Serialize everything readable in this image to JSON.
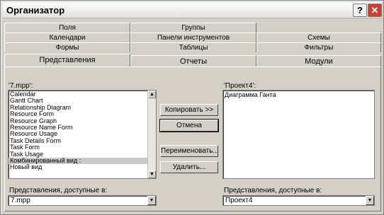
{
  "window": {
    "title": "Организатор",
    "help_label": "?",
    "close_label": "✕"
  },
  "tabs": {
    "row1": [
      "Поля",
      "Группы"
    ],
    "row2": [
      "Календари",
      "Панели инструментов",
      "Схемы"
    ],
    "row3": [
      "Формы",
      "Таблицы",
      "Фильтры"
    ],
    "row4": [
      "Представления",
      "Отчеты",
      "Модули"
    ],
    "active": "Представления"
  },
  "left": {
    "label": "'7.mpp':",
    "items": [
      "Calendar",
      "Gantt Chart",
      "Relationship Diagram",
      "Resource Form",
      "Resource Graph",
      "Resource Name Form",
      "Resource Usage",
      "Task Details Form",
      "Task Form",
      "Task Usage",
      "Комбинированный вид :",
      "Новый вид"
    ],
    "selected_index": 10,
    "available_label": "Представления, доступные в:",
    "available_value": "7.mpp"
  },
  "right": {
    "label": "'Проект4':",
    "items": [
      "Диаграмма Ганта"
    ],
    "available_label": "Представления, доступные в:",
    "available_value": "Проект4"
  },
  "buttons": {
    "copy": "Копировать >>",
    "cancel": "Отмена",
    "rename": "Переименовать...",
    "delete": "Удалить..."
  },
  "icons": {
    "scroll_up": "▲",
    "scroll_down": "▼",
    "dropdown": "▼"
  }
}
